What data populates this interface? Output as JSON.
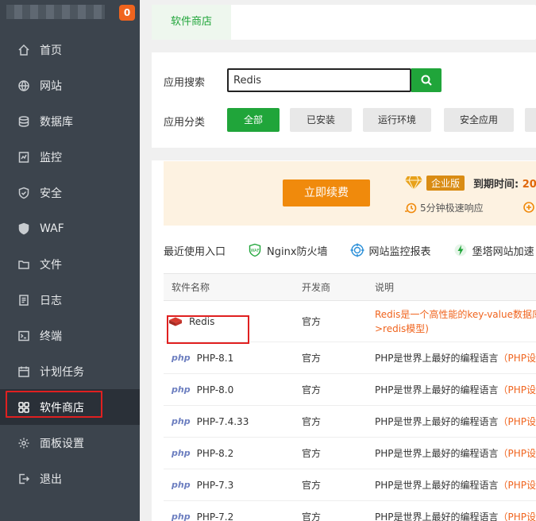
{
  "sidebar": {
    "badge_count": "0",
    "items": [
      {
        "label": "首页",
        "icon": "home-icon"
      },
      {
        "label": "网站",
        "icon": "globe-icon"
      },
      {
        "label": "数据库",
        "icon": "database-icon"
      },
      {
        "label": "监控",
        "icon": "monitor-icon"
      },
      {
        "label": "安全",
        "icon": "shield-icon"
      },
      {
        "label": "WAF",
        "icon": "waf-shield-icon"
      },
      {
        "label": "文件",
        "icon": "folder-icon"
      },
      {
        "label": "日志",
        "icon": "log-icon"
      },
      {
        "label": "终端",
        "icon": "terminal-icon"
      },
      {
        "label": "计划任务",
        "icon": "calendar-icon"
      },
      {
        "label": "软件商店",
        "icon": "grid-icon",
        "active": true
      },
      {
        "label": "面板设置",
        "icon": "gear-icon"
      },
      {
        "label": "退出",
        "icon": "logout-icon"
      }
    ]
  },
  "tabs": {
    "active": "软件商店"
  },
  "search": {
    "label": "应用搜索",
    "value": "Redis"
  },
  "category": {
    "label": "应用分类",
    "options": [
      "全部",
      "已安装",
      "运行环境",
      "安全应用"
    ]
  },
  "banner": {
    "renew_label": "立即续费",
    "edition": "企业版",
    "expire_label": "到期时间:",
    "expire_value": "20",
    "response_text": "5分钟极速响应"
  },
  "quick_links": [
    "最近使用入口",
    "Nginx防火墙",
    "网站监控报表",
    "堡塔网站加速"
  ],
  "table": {
    "headers": [
      "软件名称",
      "开发商",
      "说明"
    ],
    "redis": {
      "name": "Redis",
      "vendor": "官方",
      "desc_line1": "Redis是一个高性能的key-value数据库",
      "desc_line2": ">redis模型)"
    },
    "rows": [
      {
        "name": "PHP-8.1",
        "vendor": "官方",
        "desc": "PHP是世界上最好的编程语言",
        "link": "（PHP设"
      },
      {
        "name": "PHP-8.0",
        "vendor": "官方",
        "desc": "PHP是世界上最好的编程语言",
        "link": "（PHP设"
      },
      {
        "name": "PHP-7.4.33",
        "vendor": "官方",
        "desc": "PHP是世界上最好的编程语言",
        "link": "（PHP设"
      },
      {
        "name": "PHP-8.2",
        "vendor": "官方",
        "desc": "PHP是世界上最好的编程语言",
        "link": "（PHP设"
      },
      {
        "name": "PHP-7.3",
        "vendor": "官方",
        "desc": "PHP是世界上最好的编程语言",
        "link": "（PHP设"
      },
      {
        "name": "PHP-7.2",
        "vendor": "官方",
        "desc": "PHP是世界上最好的编程语言",
        "link": "（PHP设"
      }
    ],
    "php_logo": "php"
  }
}
